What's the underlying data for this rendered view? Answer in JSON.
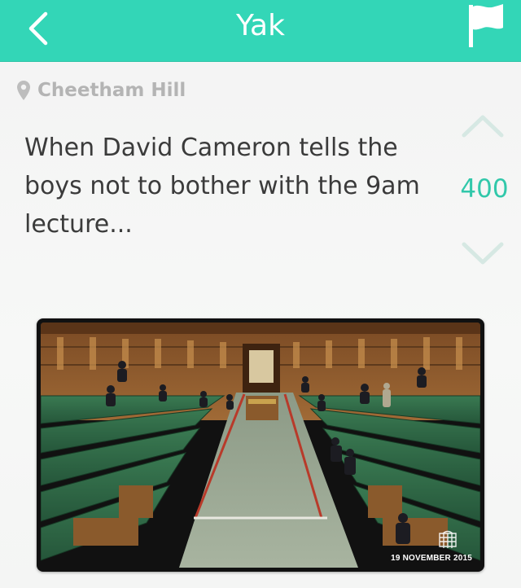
{
  "header": {
    "title": "Yak",
    "back_icon": "chevron-left-icon",
    "flag_icon": "flag-icon",
    "color": "#33d6b7"
  },
  "post": {
    "location": "Cheetham Hill",
    "location_icon": "location-pin-icon",
    "message": "When David Cameron tells the boys not to bother with the 9am lecture...",
    "score": "400",
    "upvote_icon": "chevron-up-icon",
    "downvote_icon": "chevron-down-icon",
    "image": {
      "description_icon": "photo",
      "date_caption": "19 NOVEMBER 2015",
      "watermark_icon": "portcullis-icon"
    }
  },
  "colors": {
    "accent": "#33d6b7",
    "score": "#31c8aa",
    "vote_arrow": "#d6e8e3"
  }
}
